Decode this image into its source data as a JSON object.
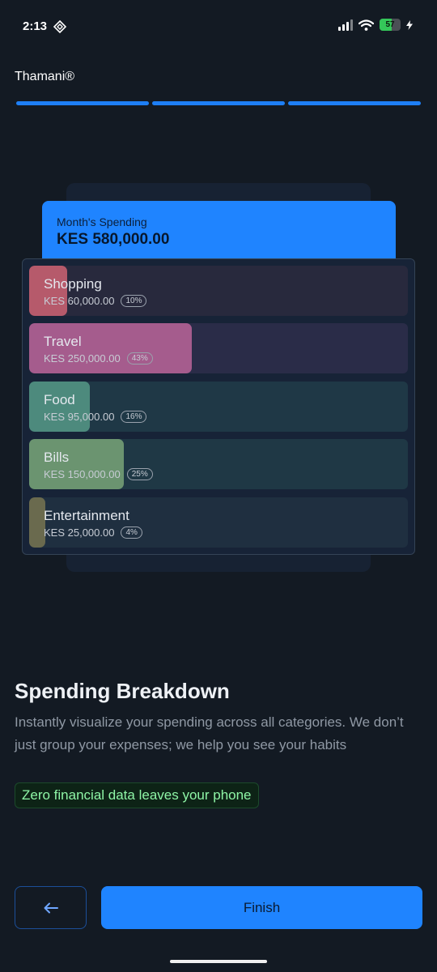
{
  "status_bar": {
    "time": "2:13",
    "battery": "57",
    "battery_level": 0.57
  },
  "header": {
    "brand": "Thamani®",
    "progress_steps": 3,
    "progress_current": 3
  },
  "summary": {
    "label": "Month's Spending",
    "value": "KES 580,000.00"
  },
  "categories": [
    {
      "name": "Shopping",
      "amount": "KES 60,000.00",
      "percent": "10%",
      "share": 0.1,
      "color": "#b65a6b",
      "bg": "#28293d"
    },
    {
      "name": "Travel",
      "amount": "KES 250,000.00",
      "percent": "43%",
      "share": 0.43,
      "color": "#a55c8d",
      "bg": "#2a2c48"
    },
    {
      "name": "Food",
      "amount": "KES 95,000.00",
      "percent": "16%",
      "share": 0.16,
      "color": "#4d8a7d",
      "bg": "#1f3846"
    },
    {
      "name": "Bills",
      "amount": "KES 150,000.00",
      "percent": "25%",
      "share": 0.25,
      "color": "#6b9470",
      "bg": "#1f3845"
    },
    {
      "name": "Entertainment",
      "amount": "KES 25,000.00",
      "percent": "4%",
      "share": 0.04,
      "color": "#6a6a4e",
      "bg": "#1f2f40"
    }
  ],
  "content": {
    "title": "Spending Breakdown",
    "description": "Instantly visualize your spending across all categories. We don’t just group your expenses; we help you see your habits",
    "privacy_badge": "Zero financial data leaves your phone"
  },
  "footer": {
    "back_icon": "arrow-left-icon",
    "finish_label": "Finish"
  }
}
